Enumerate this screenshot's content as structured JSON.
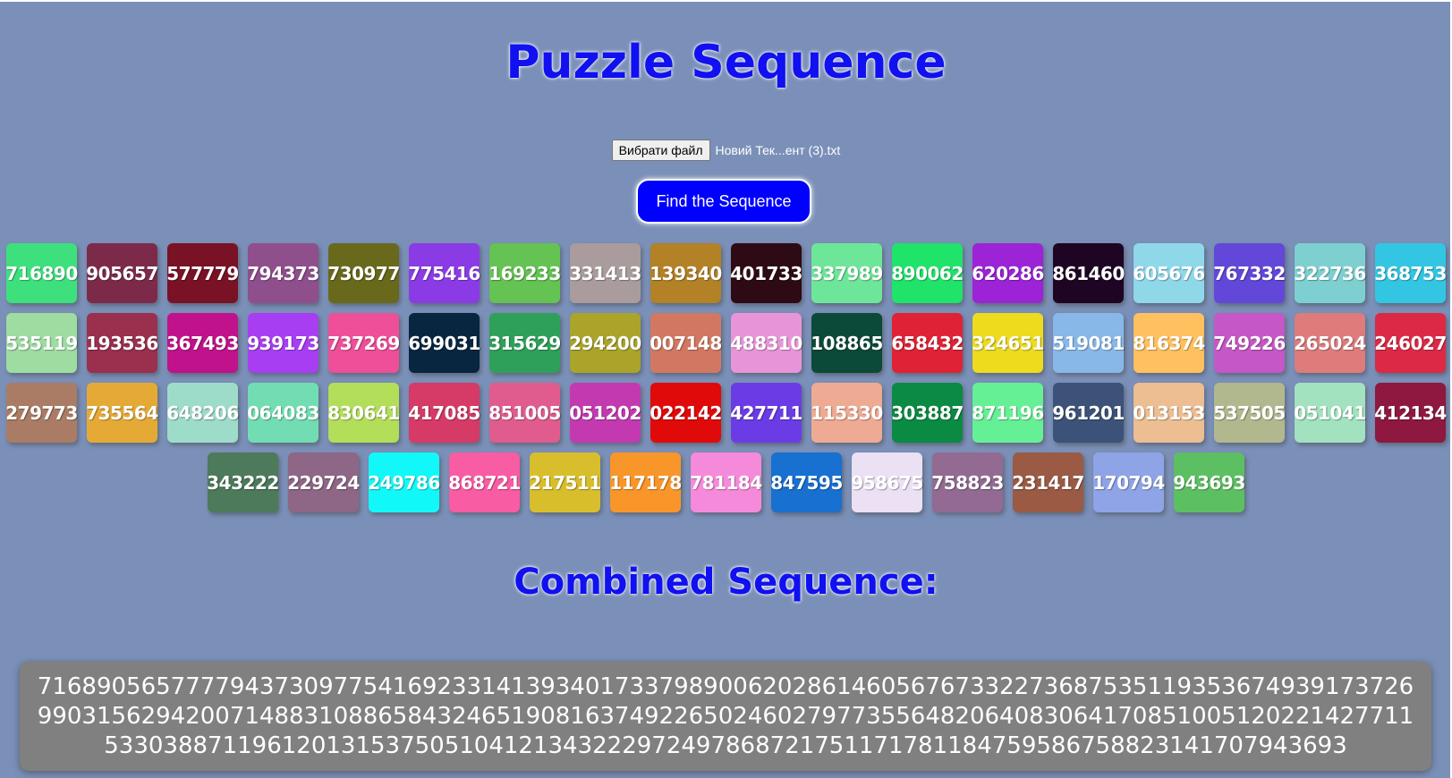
{
  "header": {
    "title": "Puzzle Sequence"
  },
  "file_input": {
    "button_label": "Вибрати файл",
    "file_name": "Новий Тек...ент (3).txt"
  },
  "find_button": {
    "label": "Find the Sequence",
    "color": "#0000ff"
  },
  "tiles": [
    [
      {
        "value": "716890",
        "color": "#3ee07e"
      },
      {
        "value": "905657",
        "color": "#7d2a4a"
      },
      {
        "value": "577779",
        "color": "#7a1226"
      },
      {
        "value": "794373",
        "color": "#8f4e8c"
      },
      {
        "value": "730977",
        "color": "#69691c"
      },
      {
        "value": "775416",
        "color": "#8b3be6"
      },
      {
        "value": "169233",
        "color": "#64c352"
      },
      {
        "value": "331413",
        "color": "#aa9c9c"
      },
      {
        "value": "139340",
        "color": "#b38126"
      },
      {
        "value": "401733",
        "color": "#2e0a14"
      },
      {
        "value": "337989",
        "color": "#6ee69a"
      },
      {
        "value": "890062",
        "color": "#20e36a"
      },
      {
        "value": "620286",
        "color": "#9c24d6"
      },
      {
        "value": "861460",
        "color": "#1e0524"
      },
      {
        "value": "605676",
        "color": "#8fd8ea"
      },
      {
        "value": "767332",
        "color": "#6347d9"
      },
      {
        "value": "322736",
        "color": "#7ed0d0"
      },
      {
        "value": "368753",
        "color": "#33c6e3"
      }
    ],
    [
      {
        "value": "535119",
        "color": "#9edca2"
      },
      {
        "value": "193536",
        "color": "#9a2f4e"
      },
      {
        "value": "367493",
        "color": "#c0128a"
      },
      {
        "value": "939173",
        "color": "#a83ef2"
      },
      {
        "value": "737269",
        "color": "#ee4f98"
      },
      {
        "value": "699031",
        "color": "#082640"
      },
      {
        "value": "315629",
        "color": "#2fa05a"
      },
      {
        "value": "294200",
        "color": "#aaa42a"
      },
      {
        "value": "007148",
        "color": "#d27862"
      },
      {
        "value": "488310",
        "color": "#e795d8"
      },
      {
        "value": "108865",
        "color": "#0b4a38"
      },
      {
        "value": "658432",
        "color": "#e02236"
      },
      {
        "value": "324651",
        "color": "#eedb1e"
      },
      {
        "value": "519081",
        "color": "#88b8e8"
      },
      {
        "value": "816374",
        "color": "#ffc060"
      },
      {
        "value": "749226",
        "color": "#c657c6"
      },
      {
        "value": "265024",
        "color": "#de7c7c"
      },
      {
        "value": "246027",
        "color": "#dc2a46"
      }
    ],
    [
      {
        "value": "279773",
        "color": "#aa7c66"
      },
      {
        "value": "735564",
        "color": "#e5aa36"
      },
      {
        "value": "648206",
        "color": "#9edcca"
      },
      {
        "value": "064083",
        "color": "#72dcb2"
      },
      {
        "value": "830641",
        "color": "#b2de5a"
      },
      {
        "value": "417085",
        "color": "#d63a66"
      },
      {
        "value": "851005",
        "color": "#e05c8e"
      },
      {
        "value": "051202",
        "color": "#c33ab0"
      },
      {
        "value": "022142",
        "color": "#e00a0a"
      },
      {
        "value": "427711",
        "color": "#6b3ce6"
      },
      {
        "value": "115330",
        "color": "#eeaa92"
      },
      {
        "value": "303887",
        "color": "#0a8a42"
      },
      {
        "value": "871196",
        "color": "#66f096"
      },
      {
        "value": "961201",
        "color": "#3c5278"
      },
      {
        "value": "013153",
        "color": "#ecbe92"
      },
      {
        "value": "537505",
        "color": "#b2b88e"
      },
      {
        "value": "051041",
        "color": "#a2e2be"
      },
      {
        "value": "412134",
        "color": "#8e1840"
      }
    ],
    [
      {
        "value": "343222",
        "color": "#4c7a5a"
      },
      {
        "value": "229724",
        "color": "#8e6686"
      },
      {
        "value": "249786",
        "color": "#12f8f8"
      },
      {
        "value": "868721",
        "color": "#f85ca2"
      },
      {
        "value": "217511",
        "color": "#d8be2c"
      },
      {
        "value": "117178",
        "color": "#f8962a"
      },
      {
        "value": "781184",
        "color": "#f68ada"
      },
      {
        "value": "847595",
        "color": "#1870d0"
      },
      {
        "value": "958675",
        "color": "#ece0f4"
      },
      {
        "value": "758823",
        "color": "#926a92"
      },
      {
        "value": "231417",
        "color": "#9a5a44"
      },
      {
        "value": "170794",
        "color": "#8ea4e6"
      },
      {
        "value": "943693",
        "color": "#5cc062"
      }
    ]
  ],
  "combined": {
    "title": "Combined Sequence:",
    "value": "716890565777794373097754169233141393401733798900620286146056767332273687535119353674939173726990315629420071488310886584324651908163749226502460279773556482064083064170851005120221427711533038871196120131537505104121343222972497868721751171781184759586758823141707943693"
  }
}
